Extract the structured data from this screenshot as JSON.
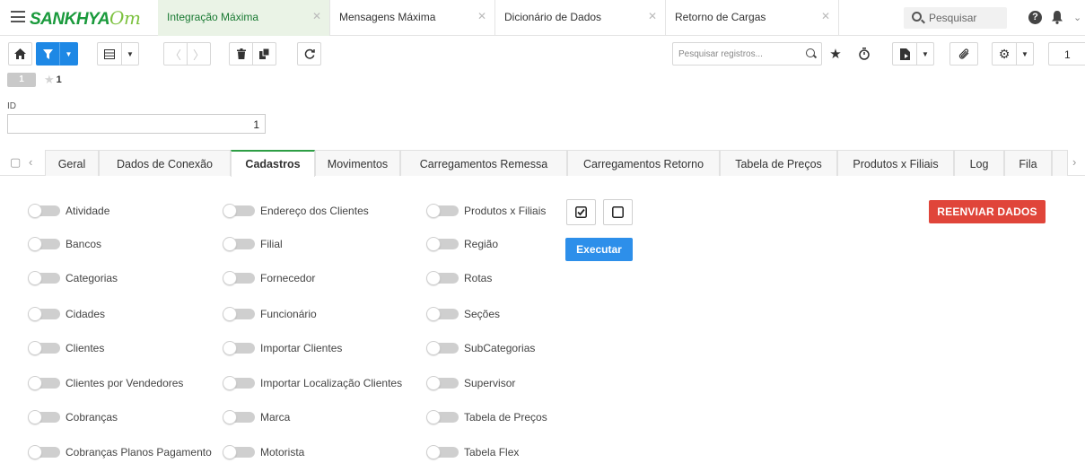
{
  "app": {
    "brand": "SANKHYA",
    "brand_suffix": "Om",
    "search_placeholder": "Pesquisar"
  },
  "window_tabs": [
    {
      "label": "Integração Máxima",
      "active": true
    },
    {
      "label": "Mensagens Máxima",
      "active": false
    },
    {
      "label": "Dicionário de Dados",
      "active": false
    },
    {
      "label": "Retorno de Cargas",
      "active": false
    }
  ],
  "toolbar": {
    "search_placeholder": "Pesquisar registros...",
    "page_number": "1"
  },
  "record": {
    "row_number": "1",
    "favorite_count": "1"
  },
  "form": {
    "id_label": "ID",
    "id_value": "1"
  },
  "form_tabs": [
    {
      "label": "Geral",
      "active": false
    },
    {
      "label": "Dados de Conexão",
      "active": false
    },
    {
      "label": "Cadastros",
      "active": true
    },
    {
      "label": "Movimentos",
      "active": false
    },
    {
      "label": "Carregamentos Remessa",
      "active": false
    },
    {
      "label": "Carregamentos Retorno",
      "active": false
    },
    {
      "label": "Tabela de Preços",
      "active": false
    },
    {
      "label": "Produtos x Filiais",
      "active": false
    },
    {
      "label": "Log",
      "active": false
    },
    {
      "label": "Fila",
      "active": false
    }
  ],
  "cadastros": {
    "col1": [
      {
        "label": "Atividade",
        "on": false
      },
      {
        "label": "Bancos",
        "on": false
      },
      {
        "label": "Categorias",
        "on": false
      },
      {
        "label": "Cidades",
        "on": false
      },
      {
        "label": "Clientes",
        "on": false
      },
      {
        "label": "Clientes por Vendedores",
        "on": false
      },
      {
        "label": "Cobranças",
        "on": false
      },
      {
        "label": "Cobranças Planos Pagamento",
        "on": false
      }
    ],
    "col2": [
      {
        "label": "Endereço dos Clientes",
        "on": false
      },
      {
        "label": "Filial",
        "on": false
      },
      {
        "label": "Fornecedor",
        "on": false
      },
      {
        "label": "Funcionário",
        "on": false
      },
      {
        "label": "Importar Clientes",
        "on": false
      },
      {
        "label": "Importar Localização Clientes",
        "on": false
      },
      {
        "label": "Marca",
        "on": false
      },
      {
        "label": "Motorista",
        "on": false
      }
    ],
    "col3": [
      {
        "label": "Produtos x Filiais",
        "on": false
      },
      {
        "label": "Região",
        "on": false
      },
      {
        "label": "Rotas",
        "on": false
      },
      {
        "label": "Seções",
        "on": false
      },
      {
        "label": "SubCategorias",
        "on": false
      },
      {
        "label": "Supervisor",
        "on": false
      },
      {
        "label": "Tabela de Preços",
        "on": false
      },
      {
        "label": "Tabela Flex",
        "on": false
      }
    ],
    "execute_label": "Executar",
    "resend_label": "REENVIAR DADOS"
  },
  "colors": {
    "brand_green": "#1a9a3c",
    "primary_blue": "#1e88e5",
    "danger_red": "#e0453a",
    "active_tab_border": "#2e9e45"
  }
}
